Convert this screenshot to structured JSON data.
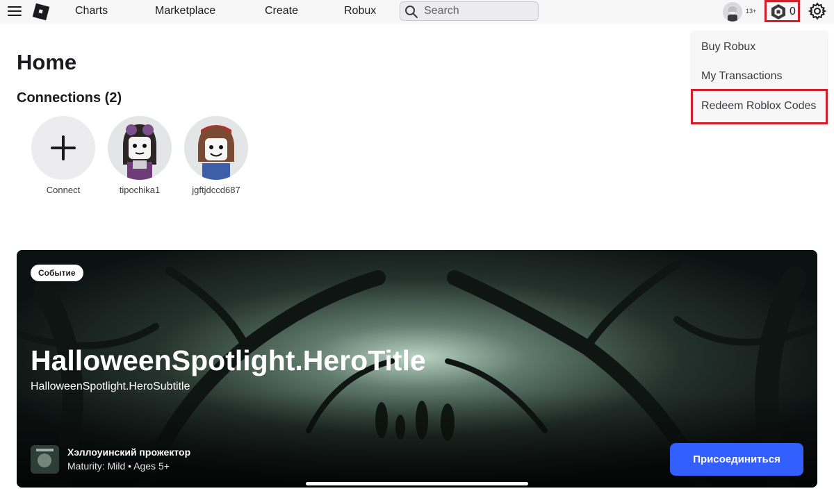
{
  "nav": {
    "menu_icon": "hamburger-menu-icon",
    "logo_icon": "roblox-logo-icon",
    "links": [
      "Charts",
      "Marketplace",
      "Create",
      "Robux"
    ],
    "search_placeholder": "Search",
    "age_badge": "13+",
    "robux_count": "0"
  },
  "dropdown": {
    "items": [
      "Buy Robux",
      "My Transactions",
      "Redeem Roblox Codes"
    ],
    "highlighted_item": "Redeem Roblox Codes",
    "highlight_color": "#d0202c"
  },
  "home": {
    "title": "Home",
    "connections_title": "Connections (2)",
    "friends": [
      {
        "name": "Connect",
        "icon": "plus-icon"
      },
      {
        "name": "tipochika1"
      },
      {
        "name": "jgftjdccd687"
      }
    ]
  },
  "hero": {
    "badge": "Событие",
    "title": "HalloweenSpotlight.HeroTitle",
    "subtitle": "HalloweenSpotlight.HeroSubtitle",
    "game_name": "Хэллоуинский прожектор",
    "maturity": "Maturity: Mild • Ages 5+",
    "join_label": "Присоединиться"
  },
  "colors": {
    "accent": "#335fff",
    "highlight": "#d0202c",
    "topbar_bg": "#f7f7f8"
  }
}
